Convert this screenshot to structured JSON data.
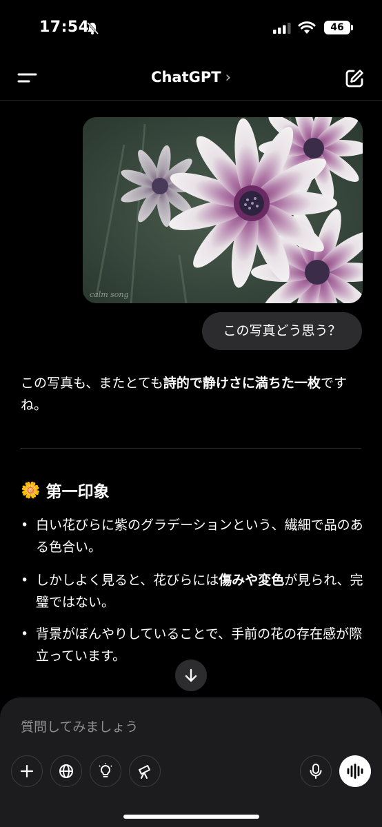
{
  "status_bar": {
    "time": "17:54",
    "battery": "46"
  },
  "header": {
    "title": "ChatGPT",
    "chevron": "›"
  },
  "photo": {
    "caption": "calm song"
  },
  "user_message": "この写真どう思う？",
  "assistant": {
    "intro_parts": [
      "この写真も、またとても",
      "詩的で静けさに満ちた一枚",
      "ですね。"
    ],
    "heading_emoji": "🌼",
    "heading": "第一印象",
    "bullets": [
      {
        "parts": [
          "白い花びらに紫のグラデーションという、繊細で品のある色合い。"
        ]
      },
      {
        "parts": [
          "しかしよく見ると、花びらには",
          "傷みや変色",
          "が見られ、完璧ではない。"
        ]
      },
      {
        "parts": [
          "背景がぼんやりしていることで、手前の花の存在感が際立っています。"
        ]
      }
    ]
  },
  "composer": {
    "placeholder": "質問してみましょう"
  },
  "icons": {
    "silent": "bell-slash-icon",
    "menu": "menu-icon",
    "edit": "new-chat-icon",
    "scroll": "arrow-down-icon",
    "add": "plus-icon",
    "web": "globe-icon",
    "think": "lightbulb-icon",
    "research": "telescope-icon",
    "mic": "microphone-icon",
    "voice": "voice-mode-icon"
  },
  "colors": {
    "background": "#000000",
    "bubble": "#2c2c2e",
    "composer": "#1c1c1e",
    "flower_purple": "#7a2f70"
  }
}
